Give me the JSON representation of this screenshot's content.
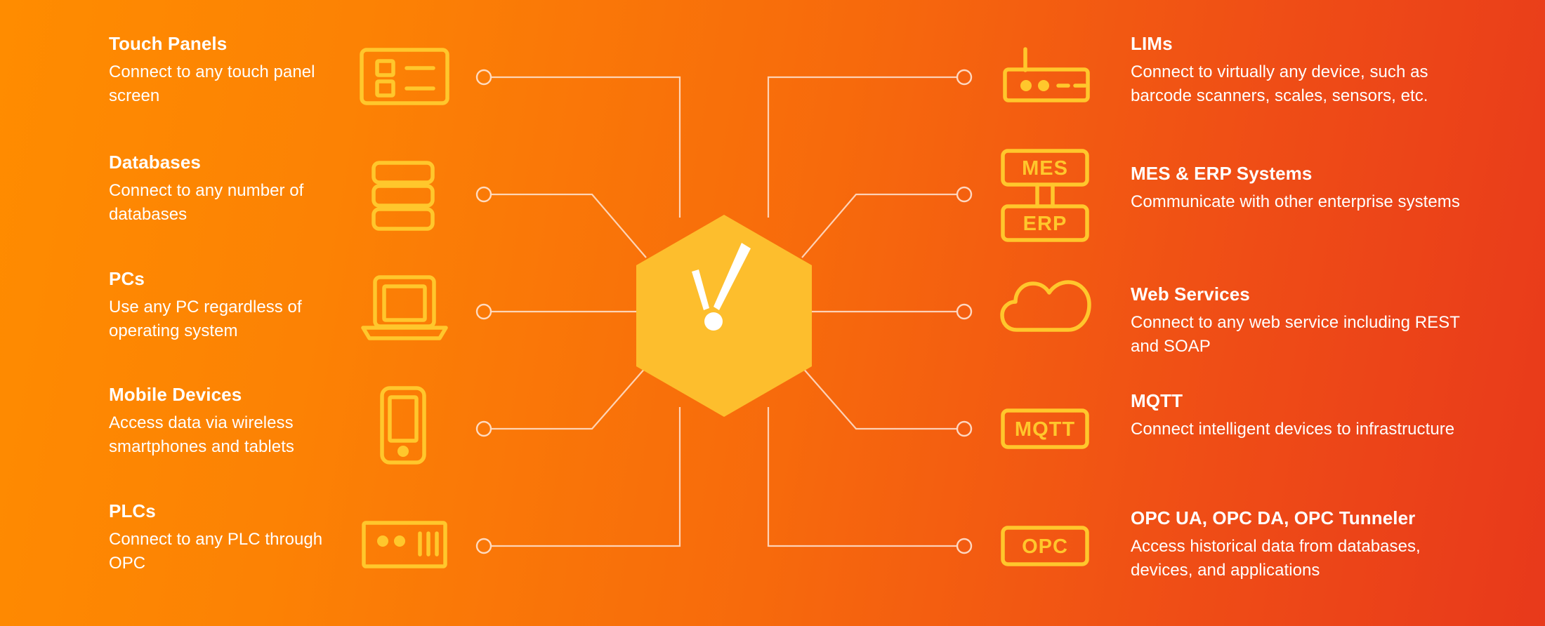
{
  "background": {
    "gradient_from": "#FF8C00",
    "gradient_to": "#E8391B"
  },
  "colors": {
    "icon_accent": "#FFC72C",
    "hex_fill": "#FDBE2D",
    "text": "#FFFFFF",
    "wire": "#FFECE1"
  },
  "center": {
    "logo_name": "ignition-hexagon-logo",
    "shape": "hexagon",
    "mark": "check-exclamation-mark"
  },
  "left_column": [
    {
      "icon": "touch-panel-icon",
      "title": "Touch Panels",
      "description": "Connect to any touch panel screen"
    },
    {
      "icon": "database-stack-icon",
      "title": "Databases",
      "description": "Connect to any number of databases"
    },
    {
      "icon": "laptop-icon",
      "title": "PCs",
      "description": "Use any PC regardless of operating system"
    },
    {
      "icon": "mobile-phone-icon",
      "title": "Mobile Devices",
      "description": "Access data via wireless smartphones and tablets"
    },
    {
      "icon": "plc-controller-icon",
      "title": "PLCs",
      "description": "Connect to any PLC through OPC"
    }
  ],
  "right_column": [
    {
      "icon": "lims-device-icon",
      "title": "LIMs",
      "description": "Connect to virtually any device, such as barcode scanners, scales, sensors, etc."
    },
    {
      "icon": "mes-erp-boxes-icon",
      "icon_labels": [
        "MES",
        "ERP"
      ],
      "title": "MES & ERP Systems",
      "description": "Communicate with other enterprise systems"
    },
    {
      "icon": "cloud-icon",
      "title": "Web Services",
      "description": "Connect to any web service including REST and SOAP"
    },
    {
      "icon": "mqtt-box-icon",
      "icon_labels": [
        "MQTT"
      ],
      "title": "MQTT",
      "description": "Connect intelligent devices to infrastructure"
    },
    {
      "icon": "opc-box-icon",
      "icon_labels": [
        "OPC"
      ],
      "title": "OPC UA, OPC DA, OPC Tunneler",
      "description": "Access historical data from databases, devices, and applications"
    }
  ]
}
